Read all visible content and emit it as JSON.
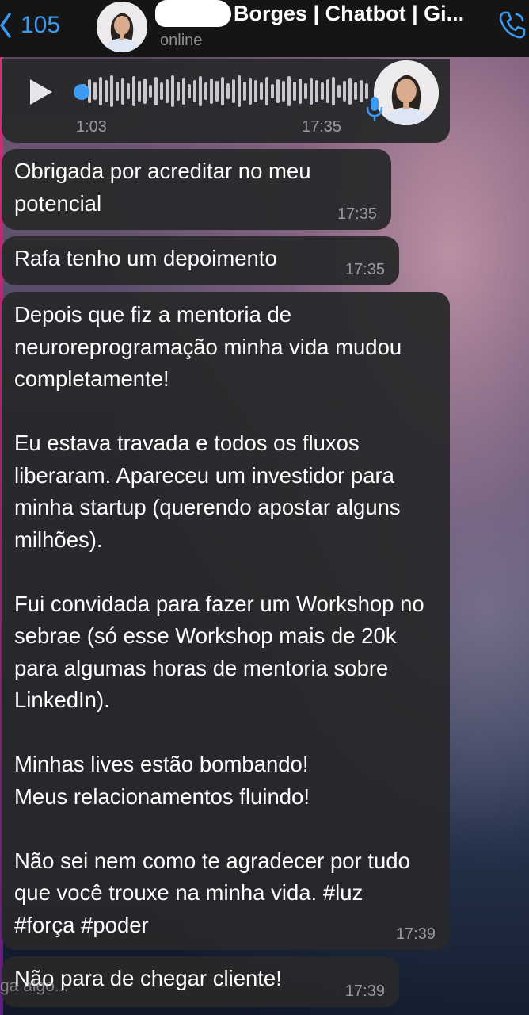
{
  "header": {
    "back_count": "105",
    "contact_name": "Leticia Borges | Chatbot | Gi...",
    "status": "online"
  },
  "voice_message": {
    "duration": "1:03",
    "time": "17:35"
  },
  "messages": [
    {
      "text": "Obrigada por acreditar no meu potencial",
      "time": "17:35"
    },
    {
      "text": "Rafa tenho um depoimento",
      "time": "17:35"
    },
    {
      "paragraphs": [
        "Depois que fiz a mentoria de neuroreprogramação minha vida mudou completamente!",
        "Eu estava travada e todos os fluxos liberaram. Apareceu um investidor para minha startup (querendo apostar alguns milhões).",
        "Fui convidada para fazer um Workshop no sebrae (só esse Workshop mais de 20k para algumas horas de mentoria sobre LinkedIn).",
        "Minhas lives estão bombando!\nMeus relacionamentos fluindo!",
        "Não sei nem como te agradecer por tudo que você trouxe na minha vida. #luz #força #poder"
      ],
      "time": "17:39"
    },
    {
      "text": "Não para de chegar cliente!",
      "time": "17:39"
    }
  ],
  "ghost_text": "ga algo...",
  "colors": {
    "accent": "#3b9bf2",
    "bubble": "#28282a",
    "header": "#151515"
  },
  "icons": {
    "back": "chevron-left-icon",
    "call": "phone-icon",
    "play": "play-icon",
    "mic": "microphone-icon"
  }
}
